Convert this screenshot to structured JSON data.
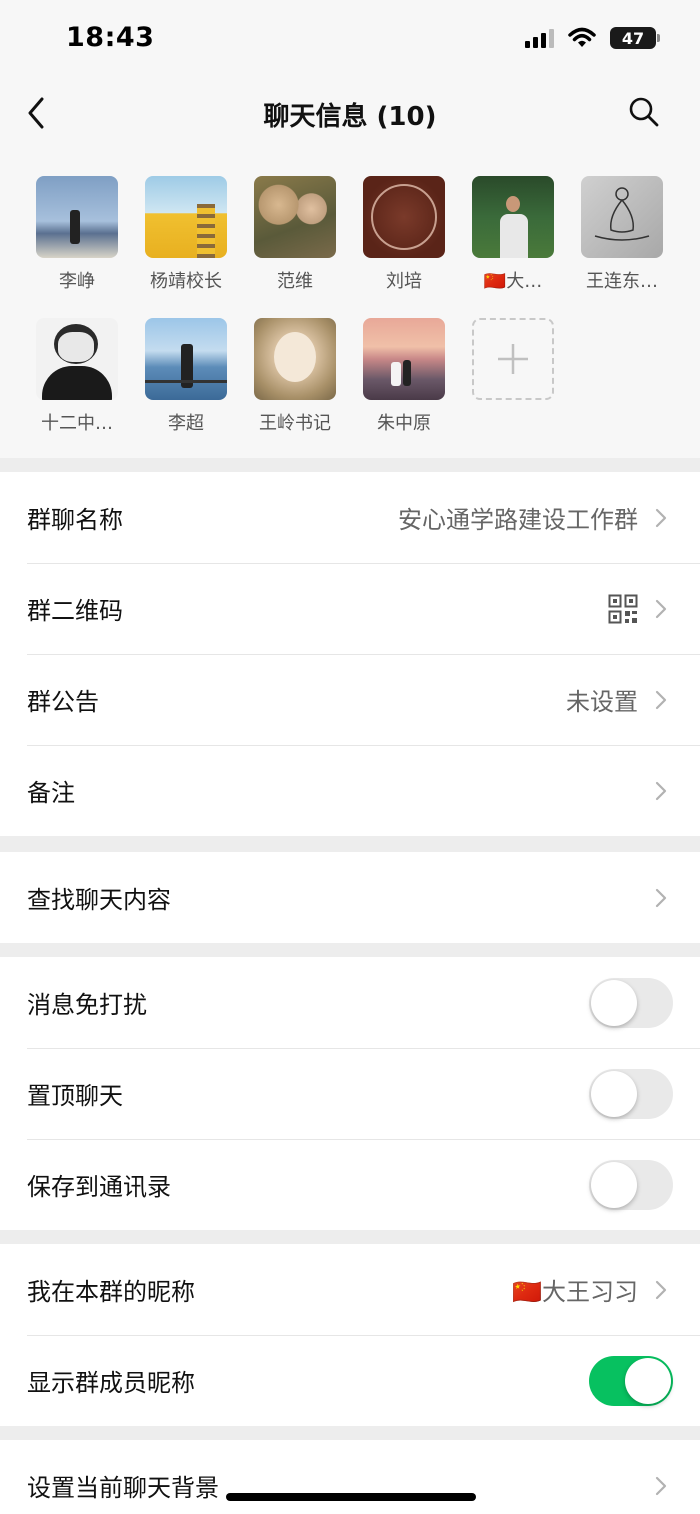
{
  "status_bar": {
    "time": "18:43",
    "battery": "47"
  },
  "nav": {
    "title": "聊天信息 (10)"
  },
  "members": [
    {
      "name": "李峥"
    },
    {
      "name": "杨靖校长"
    },
    {
      "name": "范维"
    },
    {
      "name": "刘培"
    },
    {
      "name": "🇨🇳大…"
    },
    {
      "name": "王连东…"
    },
    {
      "name": "十二中…"
    },
    {
      "name": "李超"
    },
    {
      "name": "王岭书记"
    },
    {
      "name": "朱中原"
    }
  ],
  "settings": {
    "group_name": {
      "label": "群聊名称",
      "value": "安心通学路建设工作群"
    },
    "qr_code": {
      "label": "群二维码"
    },
    "announcement": {
      "label": "群公告",
      "value": "未设置"
    },
    "remark": {
      "label": "备注"
    },
    "search_history": {
      "label": "查找聊天内容"
    },
    "mute": {
      "label": "消息免打扰",
      "on": false
    },
    "pin": {
      "label": "置顶聊天",
      "on": false
    },
    "save_contacts": {
      "label": "保存到通讯录",
      "on": false
    },
    "my_nickname": {
      "label": "我在本群的昵称",
      "value": "🇨🇳大王习习"
    },
    "show_nicknames": {
      "label": "显示群成员昵称",
      "on": true
    },
    "background": {
      "label": "设置当前聊天背景"
    }
  },
  "colors": {
    "toggle_on": "#07c160",
    "page_bg": "#ededed"
  }
}
